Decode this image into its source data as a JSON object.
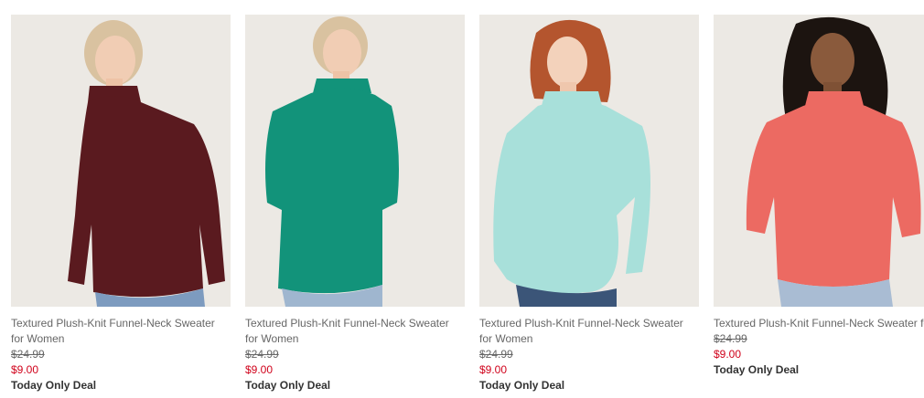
{
  "products": [
    {
      "name": "Textured Plush-Knit Funnel-Neck Sweater for Women",
      "regular_price": "$24.99",
      "sale_price": "$9.00",
      "deal_label": "Today Only Deal",
      "sweater_color": "#5a1a1f",
      "background_color": "#ece9e4",
      "hair_color": "#d9c2a0"
    },
    {
      "name": "Textured Plush-Knit Funnel-Neck Sweater for Women",
      "regular_price": "$24.99",
      "sale_price": "$9.00",
      "deal_label": "Today Only Deal",
      "sweater_color": "#12937a",
      "background_color": "#ece9e4",
      "hair_color": "#d9c2a0"
    },
    {
      "name": "Textured Plush-Knit Funnel-Neck Sweater for Women",
      "regular_price": "$24.99",
      "sale_price": "$9.00",
      "deal_label": "Today Only Deal",
      "sweater_color": "#a8e0da",
      "background_color": "#ece9e4",
      "hair_color": "#b4552e"
    },
    {
      "name": "Textured Plush-Knit Funnel-Neck Sweater for Women",
      "regular_price": "$24.99",
      "sale_price": "$9.00",
      "deal_label": "Today Only Deal",
      "sweater_color": "#ec6a62",
      "background_color": "#ece9e4",
      "hair_color": "#1c1410"
    }
  ]
}
